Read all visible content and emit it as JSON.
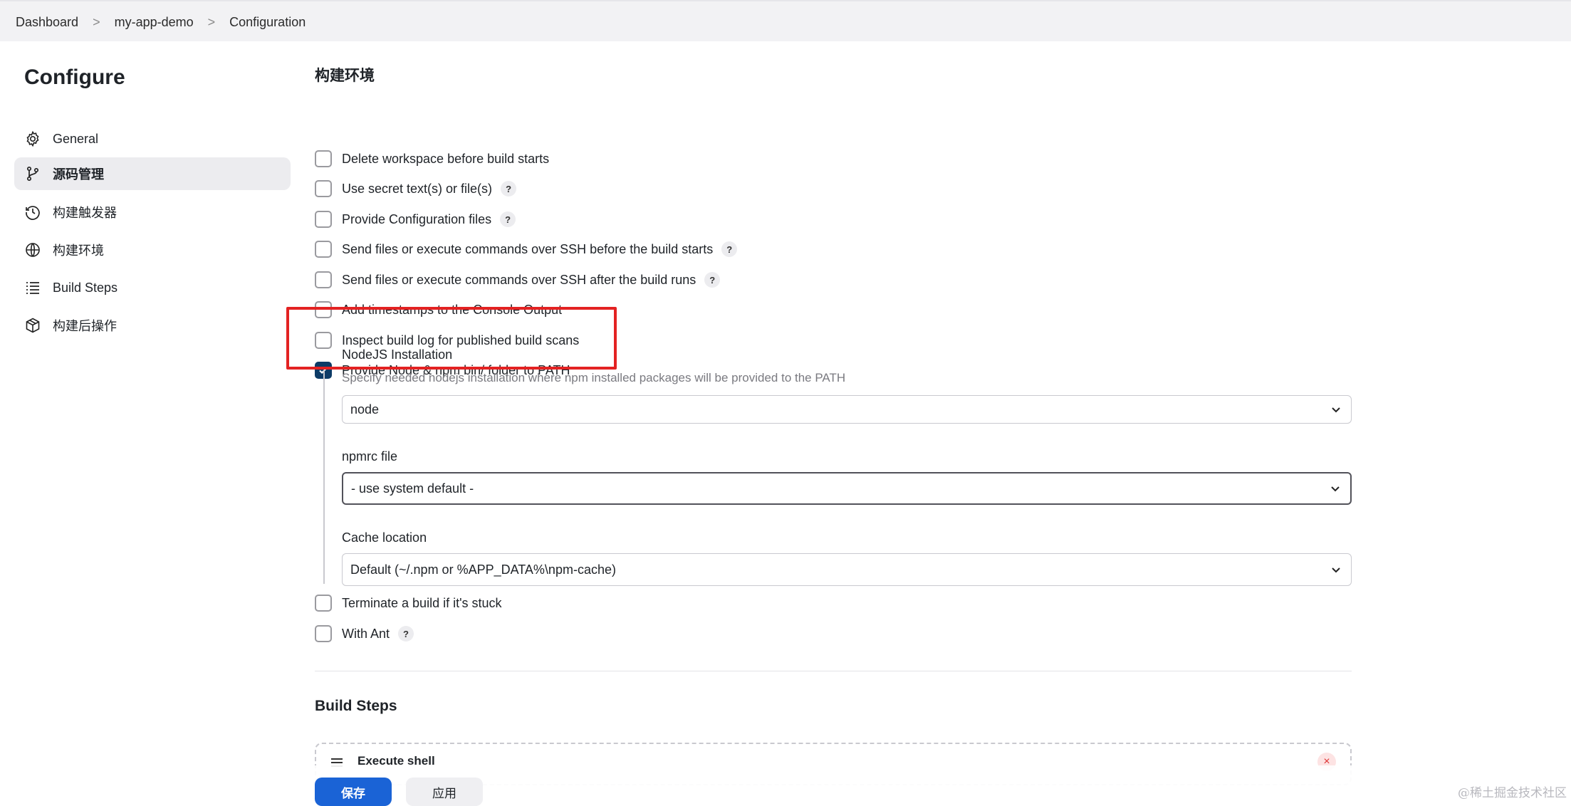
{
  "breadcrumb": {
    "items": [
      "Dashboard",
      "my-app-demo",
      "Configuration"
    ],
    "separator": ">"
  },
  "sidebar": {
    "title": "Configure",
    "items": [
      {
        "label": "General",
        "icon": "gear-icon"
      },
      {
        "label": "源码管理",
        "icon": "git-branch-icon",
        "active": true
      },
      {
        "label": "构建触发器",
        "icon": "clock-icon"
      },
      {
        "label": "构建环境",
        "icon": "globe-icon"
      },
      {
        "label": "Build Steps",
        "icon": "list-icon"
      },
      {
        "label": "构建后操作",
        "icon": "package-icon"
      }
    ]
  },
  "build_env": {
    "title": "构建环境",
    "options": [
      {
        "label": "Delete workspace before build starts",
        "checked": false,
        "help": false
      },
      {
        "label": "Use secret text(s) or file(s)",
        "checked": false,
        "help": true
      },
      {
        "label": "Provide Configuration files",
        "checked": false,
        "help": true
      },
      {
        "label": "Send files or execute commands over SSH before the build starts",
        "checked": false,
        "help": true
      },
      {
        "label": "Send files or execute commands over SSH after the build runs",
        "checked": false,
        "help": true
      },
      {
        "label": "Add timestamps to the Console Output",
        "checked": false,
        "help": false
      },
      {
        "label": "Inspect build log for published build scans",
        "checked": false,
        "help": false
      },
      {
        "label": "Provide Node & npm bin/ folder to PATH",
        "checked": true,
        "help": false
      }
    ],
    "nodejs": {
      "installation_label": "NodeJS Installation",
      "installation_desc": "Specify needed nodejs installation where npm installed packages will be provided to the PATH",
      "installation_value": "node",
      "npmrc_label": "npmrc file",
      "npmrc_value": "- use system default -",
      "cache_label": "Cache location",
      "cache_value": "Default (~/.npm or %APP_DATA%\\npm-cache)"
    },
    "options_after": [
      {
        "label": "Terminate a build if it's stuck",
        "checked": false,
        "help": false
      },
      {
        "label": "With Ant",
        "checked": false,
        "help": true
      }
    ],
    "help_glyph": "?"
  },
  "build_steps": {
    "title": "Build Steps",
    "step_title": "Execute shell",
    "close_glyph": "×"
  },
  "actions": {
    "save": "保存",
    "apply": "应用"
  },
  "watermark": "@稀土掘金技术社区",
  "colors": {
    "accent": "#1a63d6",
    "checkbox_checked": "#0d3b66",
    "highlight": "#e32222",
    "sidebar_active": "#ececef"
  }
}
